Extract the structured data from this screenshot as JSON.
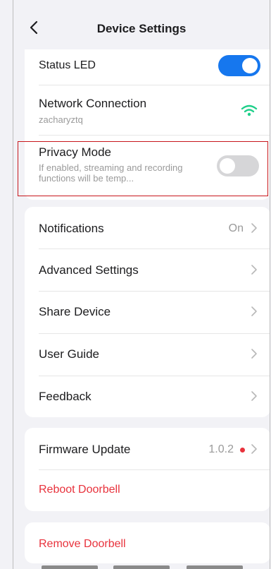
{
  "header": {
    "title": "Device Settings"
  },
  "group1": {
    "status_led": {
      "label": "Status LED",
      "enabled": true
    },
    "network": {
      "label": "Network Connection",
      "ssid": "zacharyztq"
    },
    "privacy": {
      "label": "Privacy Mode",
      "description": "If enabled, streaming and recording functions will be temp...",
      "enabled": false
    }
  },
  "group2": {
    "items": [
      {
        "label": "Notifications",
        "value": "On"
      },
      {
        "label": "Advanced Settings",
        "value": ""
      },
      {
        "label": "Share Device",
        "value": ""
      },
      {
        "label": "User Guide",
        "value": ""
      },
      {
        "label": "Feedback",
        "value": ""
      }
    ]
  },
  "group3": {
    "firmware": {
      "label": "Firmware Update",
      "version": "1.0.2"
    },
    "reboot": {
      "label": "Reboot Doorbell"
    }
  },
  "group4": {
    "remove": {
      "label": "Remove Doorbell"
    }
  },
  "colors": {
    "accent": "#1677ee",
    "danger": "#e8323c",
    "wifi": "#1fcf8a"
  },
  "icons": {
    "back": "chevron-left-icon",
    "wifi": "wifi-icon",
    "chevron": "chevron-right-icon"
  }
}
